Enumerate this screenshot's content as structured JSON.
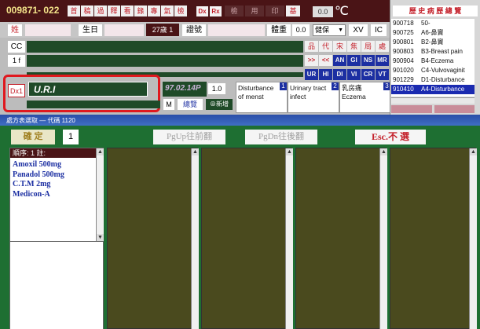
{
  "header": {
    "patient_id": "009871- 022",
    "toolbar_chars": [
      "首",
      "稿",
      "過",
      "釋",
      "看",
      "錄",
      "專",
      "氣",
      "檢"
    ],
    "dx_tag": "Dx",
    "rx_tag": "Rx",
    "toolbar_chars2": [
      "檢",
      "用",
      "印",
      "基"
    ],
    "temp_value": "0.0",
    "temp_unit": "℃"
  },
  "row2": {
    "name_label": "姓",
    "birth_label": "生日",
    "age_badge": "27歲 1",
    "id_label": "證號",
    "weight_label": "體重",
    "weight_value": "0.0",
    "category_select": "健保",
    "category_code": "XV",
    "ic_label": "IC"
  },
  "side_buttons": {
    "cc_label": "CC",
    "row4_label": "1 f",
    "blue_row": [
      ">>",
      "<<",
      "AN",
      "GI",
      "NS",
      "MR"
    ],
    "blue_row2": [
      "UR",
      "HI",
      "DI",
      "VI",
      "CR",
      "VT"
    ],
    "top_chars": [
      "品",
      "代",
      "宋",
      "焦",
      "局",
      "處"
    ]
  },
  "history": {
    "title": "歷 史 病 歷 總 覽",
    "entries": [
      {
        "date": "900718",
        "code": "50-"
      },
      {
        "date": "900725",
        "code": "A6-鼻竇"
      },
      {
        "date": "900801",
        "code": "B2-鼻竇"
      },
      {
        "date": "900803",
        "code": "B3-Breast pain"
      },
      {
        "date": "900904",
        "code": "B4-Eczema"
      },
      {
        "date": "901020",
        "code": "C4-Vulvovaginit"
      },
      {
        "date": "901229",
        "code": "D1-Disturbance"
      },
      {
        "date": "910410",
        "code": "A4-Disturbance"
      }
    ]
  },
  "dx": {
    "label": "Dx1",
    "value": "U.R.I",
    "date_value": "97.02.14P",
    "count_value": "1.0",
    "m_label": "M",
    "aggregate_label": "總覽",
    "new_label": "新增"
  },
  "dx_suggestions": [
    {
      "num": "1",
      "text": "Disturbance of menst"
    },
    {
      "num": "2",
      "text": "Urinary tract infect"
    },
    {
      "num": "3",
      "text": "乳房痛 Eczema"
    }
  ],
  "dialog": {
    "title": "處方表選取 — 代碼  1120",
    "confirm_button": "確 定",
    "page_number": "1",
    "pgup_button": "PgUp往前翻",
    "pgdn_button": "PgDn往後翻",
    "esc_button": "Esc.不 選"
  },
  "prescription": {
    "header": "順序: 1 註:",
    "items": [
      "Amoxil 500mg",
      "Panadol 500mg",
      "C.T.M 2mg",
      "Medicon-A"
    ]
  },
  "colors": {
    "header_dark": "#4a1416",
    "accent_red": "#c4202a",
    "grid_green": "#1e6f32",
    "panel_olive": "#4a4a1e",
    "history_select": "#1a2ab0",
    "list_blue": "#1c2fa2",
    "highlight_red_box": "#e0181e"
  }
}
